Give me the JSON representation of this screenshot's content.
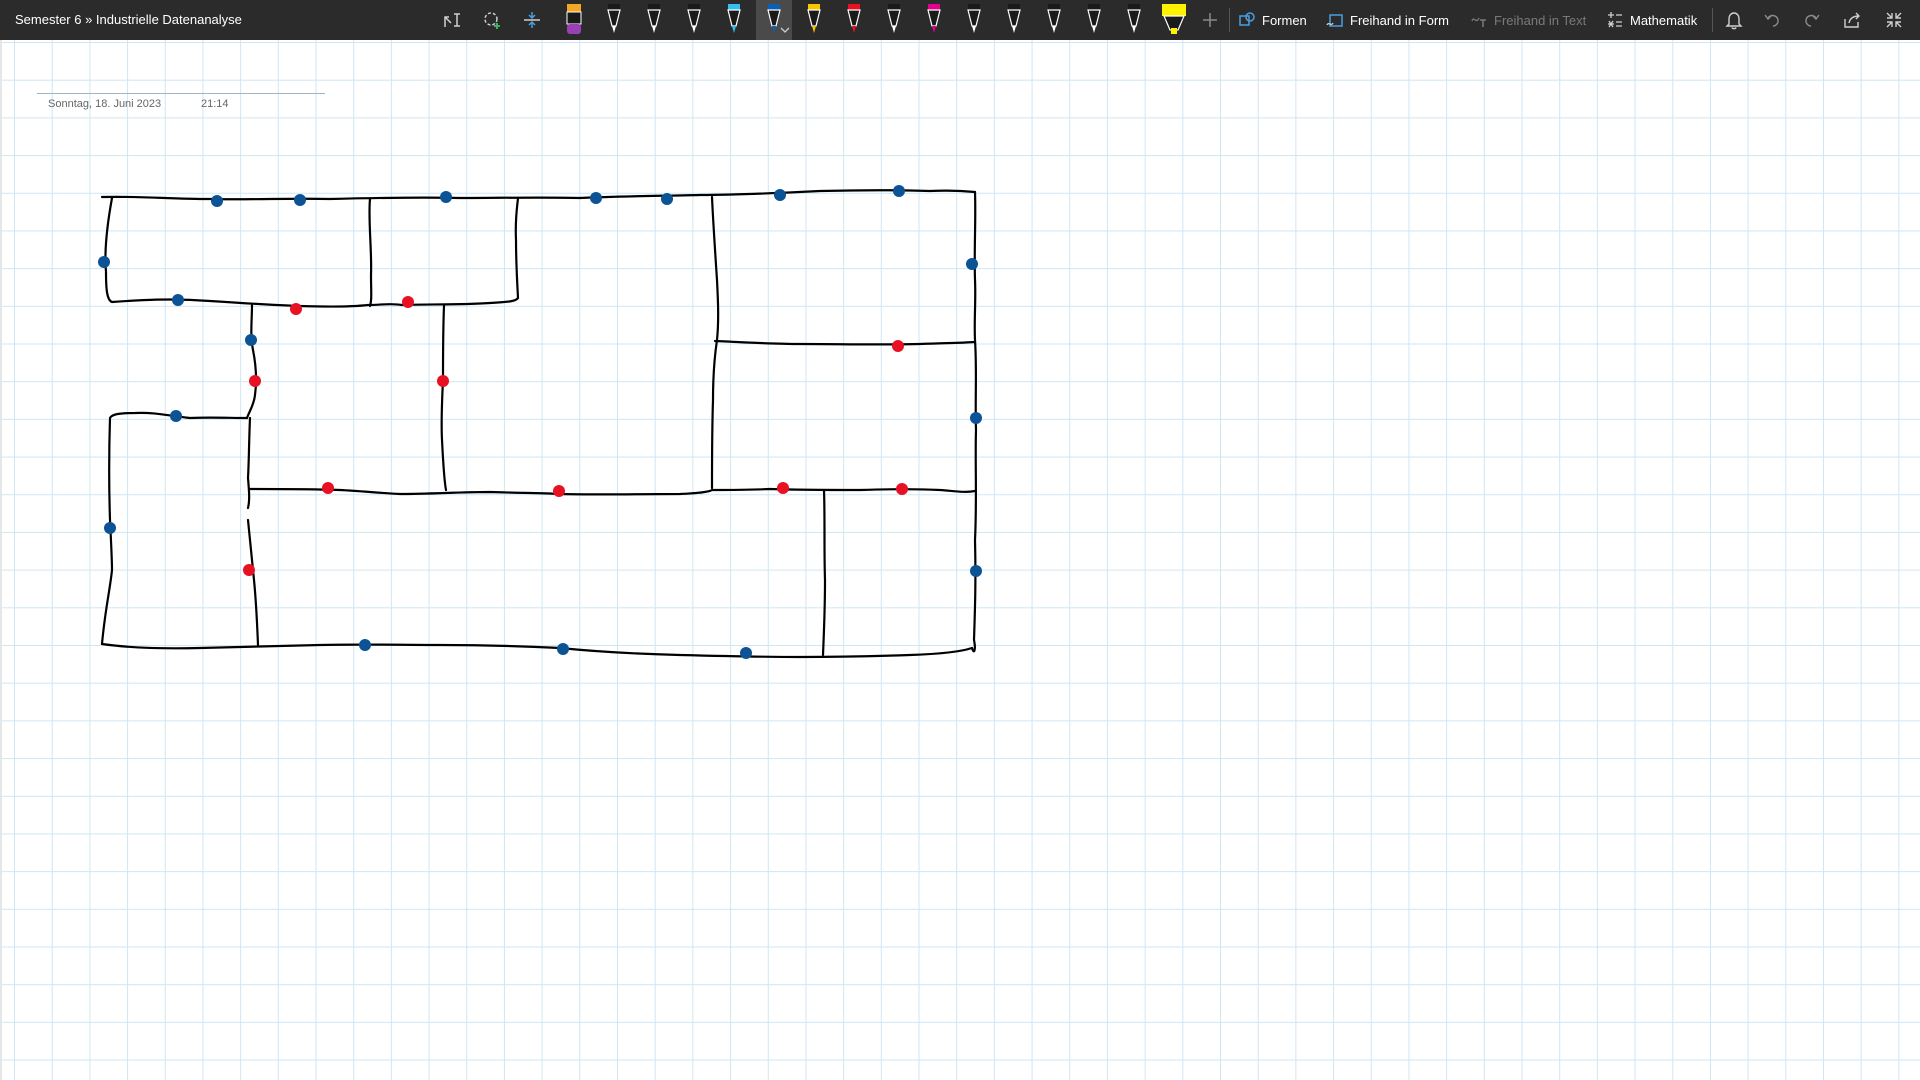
{
  "breadcrumb": "Semester 6 » Industrielle Datenanalyse",
  "toolbar": {
    "tools": [
      {
        "name": "lasso-text-select-icon"
      },
      {
        "name": "lasso-add-icon"
      },
      {
        "name": "add-space-icon"
      }
    ],
    "pens": [
      {
        "name": "pen-orange-purple",
        "tip": "#f5a623",
        "body": "#9b3fb5"
      },
      {
        "name": "pen-black-1",
        "tip": "#000000",
        "body": "#000000"
      },
      {
        "name": "pen-black-2",
        "tip": "#000000",
        "body": "#000000"
      },
      {
        "name": "pen-black-3",
        "tip": "#000000",
        "body": "#000000"
      },
      {
        "name": "pen-cyan",
        "tip": "#35c0f0",
        "body": "#35c0f0"
      },
      {
        "name": "pen-blue-selected",
        "tip": "#0b5fb5",
        "body": "#0b5fb5"
      },
      {
        "name": "pen-yellow",
        "tip": "#f7c600",
        "body": "#f7c600"
      },
      {
        "name": "pen-red",
        "tip": "#e81123",
        "body": "#e81123"
      },
      {
        "name": "pen-black-4",
        "tip": "#000000",
        "body": "#000000"
      },
      {
        "name": "pen-pink",
        "tip": "#e3008c",
        "body": "#e3008c"
      },
      {
        "name": "pen-black-5",
        "tip": "#000000",
        "body": "#000000"
      },
      {
        "name": "pen-black-6",
        "tip": "#000000",
        "body": "#000000"
      },
      {
        "name": "pen-black-7",
        "tip": "#000000",
        "body": "#000000"
      },
      {
        "name": "pen-black-8",
        "tip": "#000000",
        "body": "#000000"
      },
      {
        "name": "pen-black-9",
        "tip": "#000000",
        "body": "#000000"
      },
      {
        "name": "highlighter-yellow",
        "tip": "#fff100",
        "body": "#fff100"
      }
    ],
    "shapes_label": "Formen",
    "ink_to_shape_label": "Freihand in Form",
    "ink_to_text_label": "Freihand in Text",
    "math_label": "Mathematik"
  },
  "note": {
    "date": "Sonntag, 18. Juni 2023",
    "time": "21:14"
  },
  "colors": {
    "ink": "#000000",
    "dot_blue": "#0b5394",
    "dot_red": "#e81123",
    "grid": "#cfe6f4",
    "toolbar_bg": "#2b2b2b"
  }
}
